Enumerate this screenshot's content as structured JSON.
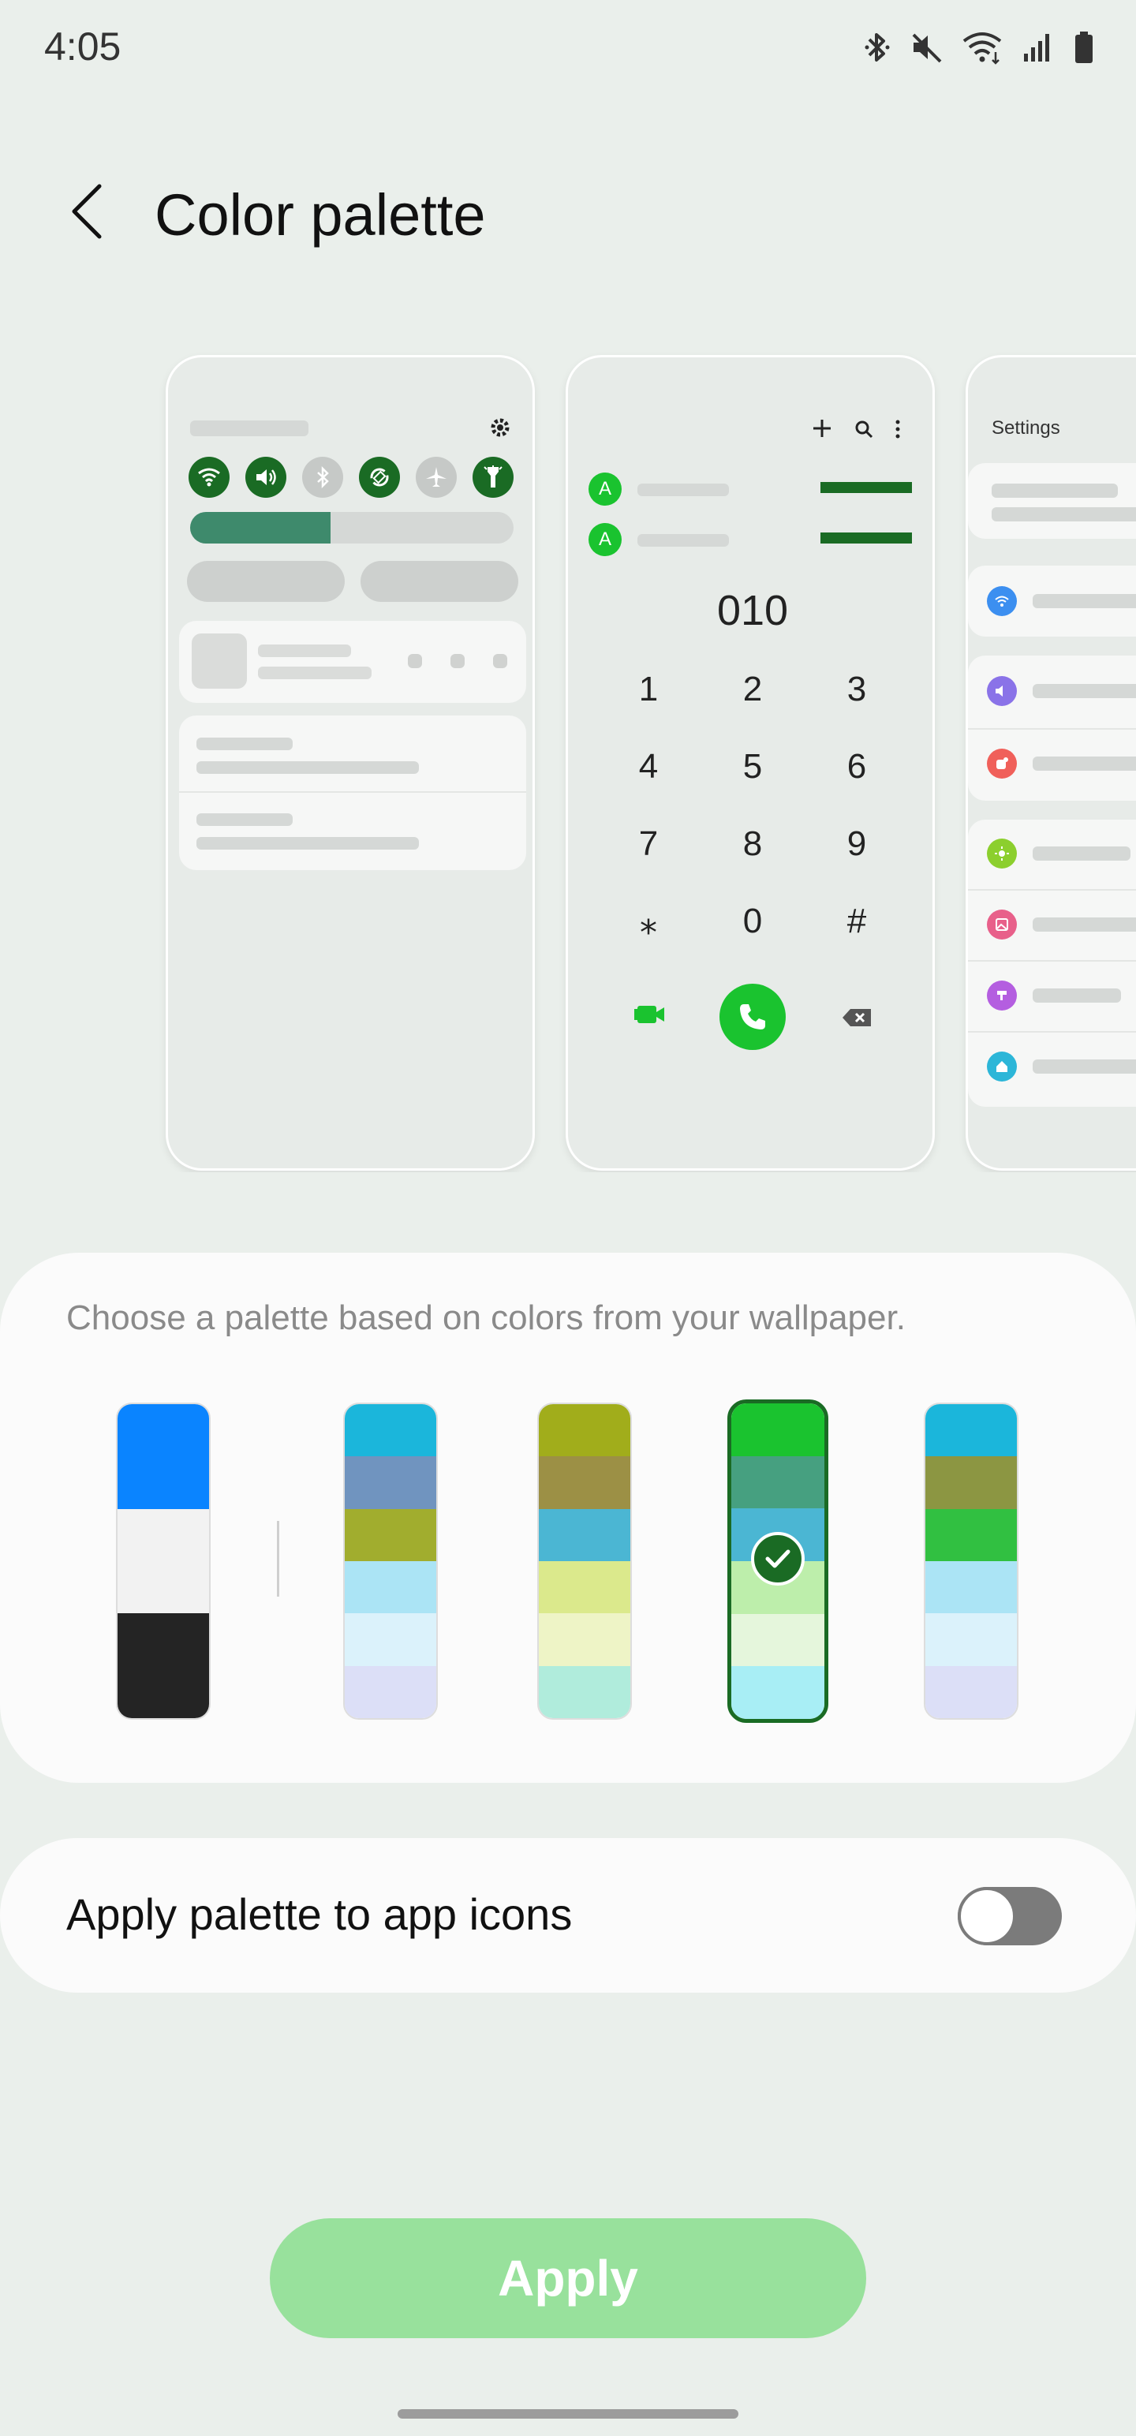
{
  "status_bar": {
    "time": "4:05",
    "icons": [
      "bluetooth-icon",
      "mute-icon",
      "wifi-icon",
      "signal-icon",
      "battery-icon"
    ]
  },
  "header": {
    "title": "Color palette",
    "back_icon": "back-arrow-icon"
  },
  "previews": {
    "dialer": {
      "number": "010",
      "keys": [
        "1",
        "2",
        "3",
        "4",
        "5",
        "6",
        "7",
        "8",
        "9",
        "⁎",
        "0",
        "#"
      ],
      "contact_initial": "A"
    },
    "settings": {
      "title": "Settings"
    }
  },
  "palette": {
    "hint": "Choose a palette based on colors from your wallpaper.",
    "selected_index": 3,
    "options": [
      {
        "colors": [
          "#0a84ff",
          "#f2f2f2",
          "#242424"
        ]
      },
      {
        "colors": [
          "#1bb6db",
          "#7094bf",
          "#a1ad2e",
          "#abe4f5",
          "#dbf2fb",
          "#dcdff7"
        ]
      },
      {
        "colors": [
          "#a1ad1b",
          "#9c9045",
          "#4bb6d3",
          "#dbe98c",
          "#eef4c6",
          "#b0ecdc"
        ]
      },
      {
        "colors": [
          "#1ac32f",
          "#46a080",
          "#4bb6d3",
          "#bdeeab",
          "#e5f6dc",
          "#a8eef5"
        ]
      },
      {
        "colors": [
          "#1bb6db",
          "#8c9642",
          "#31c041",
          "#abe4f5",
          "#dbf2fb",
          "#dcdff7"
        ]
      }
    ]
  },
  "app_icons": {
    "label": "Apply palette to app icons",
    "enabled": false
  },
  "apply_button": {
    "label": "Apply"
  },
  "colors": {
    "accent": "#1a6b24",
    "apply_bg": "#98e19c",
    "background": "#eaefeb"
  }
}
